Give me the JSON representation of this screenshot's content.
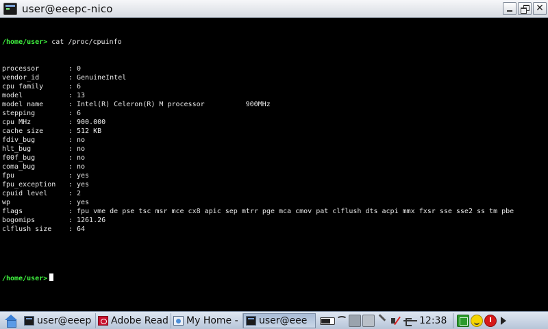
{
  "window": {
    "title": "user@eeepc-nico"
  },
  "terminal": {
    "prompt": "/home/user>",
    "command": "cat /proc/cpuinfo",
    "separator": ":",
    "lines": [
      {
        "key": "processor",
        "value": "0"
      },
      {
        "key": "vendor_id",
        "value": "GenuineIntel"
      },
      {
        "key": "cpu family",
        "value": "6"
      },
      {
        "key": "model",
        "value": "13"
      },
      {
        "key": "model name",
        "value": "Intel(R) Celeron(R) M processor",
        "extra": "900MHz"
      },
      {
        "key": "stepping",
        "value": "6"
      },
      {
        "key": "cpu MHz",
        "value": "900.000"
      },
      {
        "key": "cache size",
        "value": "512 KB"
      },
      {
        "key": "fdiv_bug",
        "value": "no"
      },
      {
        "key": "hlt_bug",
        "value": "no"
      },
      {
        "key": "f00f_bug",
        "value": "no"
      },
      {
        "key": "coma_bug",
        "value": "no"
      },
      {
        "key": "fpu",
        "value": "yes"
      },
      {
        "key": "fpu_exception",
        "value": "yes"
      },
      {
        "key": "cpuid level",
        "value": "2"
      },
      {
        "key": "wp",
        "value": "yes"
      },
      {
        "key": "flags",
        "value": "fpu vme de pse tsc msr mce cx8 apic sep mtrr pge mca cmov pat clflush dts acpi mmx fxsr sse sse2 ss tm pbe"
      },
      {
        "key": "bogomips",
        "value": "1261.26"
      },
      {
        "key": "clflush size",
        "value": "64"
      }
    ]
  },
  "taskbar": {
    "tasks": [
      {
        "label": "user@eeep",
        "icon": "terminal-icon",
        "active": false
      },
      {
        "label": "Adobe Read",
        "icon": "pdf-icon",
        "active": false
      },
      {
        "label": "My Home -",
        "icon": "browser-icon",
        "active": false
      },
      {
        "label": "user@eee",
        "icon": "terminal-icon",
        "active": true
      }
    ],
    "clock": "12:38"
  }
}
